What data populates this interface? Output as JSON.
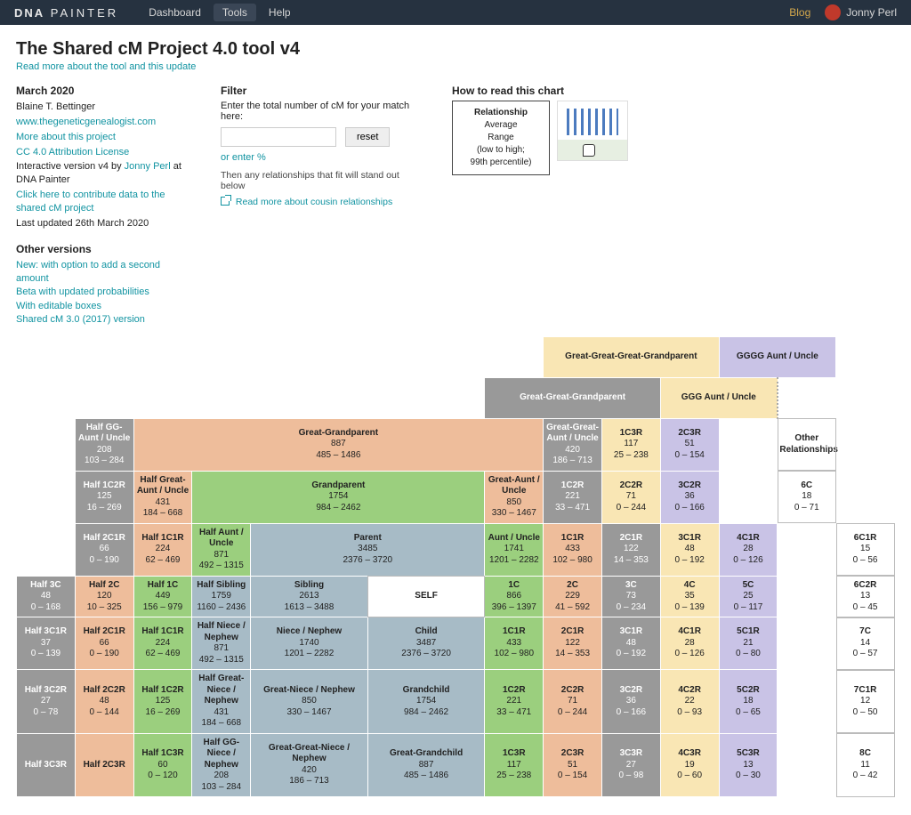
{
  "nav": {
    "logo_a": "DNA",
    "logo_b": "PAINTER",
    "items": [
      "Dashboard",
      "Tools",
      "Help"
    ],
    "active_index": 1,
    "blog": "Blog",
    "user": "Jonny Perl"
  },
  "page": {
    "title": "The Shared cM Project 4.0 tool v4",
    "sub_link": "Read more about the tool and this update"
  },
  "meta": {
    "date_heading": "March 2020",
    "author": "Blaine T. Bettinger",
    "site_link": "www.thegeneticgenealogist.com",
    "more_link": "More about this project",
    "license_link": "CC 4.0 Attribution License",
    "interactive_prefix": "Interactive version v4 by ",
    "interactive_link": "Jonny Perl",
    "interactive_mid": " at ",
    "interactive_suffix": "DNA Painter",
    "contribute_link": "Click here to contribute data to the shared cM project",
    "last_updated": "Last updated 26th March 2020"
  },
  "other": {
    "heading": "Other versions",
    "links": [
      "New: with option to add a second amount",
      "Beta with updated probabilities",
      "With editable boxes",
      "Shared cM 3.0 (2017) version"
    ]
  },
  "filter": {
    "heading": "Filter",
    "prompt": "Enter the total number of cM for your match here:",
    "placeholder": "",
    "reset": "reset",
    "pct": "or enter %",
    "hint": "Then any relationships that fit will stand out below",
    "more": "Read more about cousin relationships"
  },
  "howto": {
    "heading": "How to read this chart",
    "rel": "Relationship",
    "avg": "Average",
    "range": "Range",
    "note1": "(low to high;",
    "note2": "99th percentile)"
  },
  "top_labels": {
    "ggg_grand": "Great-Great-Great-Grandparent",
    "gggg_au": "GGGG Aunt / Uncle",
    "gg_grand": "Great-Great-Grandparent",
    "ggg_au": "GGG Aunt / Uncle"
  },
  "chart_data": {
    "type": "table",
    "note": "Cells list [label, average_cM, range_string]; null = empty cell; spans noted in markup.",
    "rows": [
      {
        "r": 1,
        "cells": {
          "half_gg_au": [
            "Half GG-Aunt / Uncle",
            208,
            "103 – 284"
          ],
          "g_grand": [
            "Great-Grandparent",
            887,
            "485 – 1486"
          ],
          "gg_au": [
            "Great-Great-Aunt / Uncle",
            420,
            "186 – 713"
          ],
          "1c3r": [
            "1C3R",
            117,
            "25 – 238"
          ],
          "2c3r": [
            "2C3R",
            51,
            "0 – 154"
          ],
          "other": [
            "Other Relationships",
            null,
            null
          ]
        }
      },
      {
        "r": 2,
        "cells": {
          "half_1c2r": [
            "Half 1C2R",
            125,
            "16 – 269"
          ],
          "half_g_au": [
            "Half Great-Aunt / Uncle",
            431,
            "184 – 668"
          ],
          "grand": [
            "Grandparent",
            1754,
            "984 – 2462"
          ],
          "g_au": [
            "Great-Aunt / Uncle",
            850,
            "330 – 1467"
          ],
          "1c2r": [
            "1C2R",
            221,
            "33 – 471"
          ],
          "2c2r": [
            "2C2R",
            71,
            "0 – 244"
          ],
          "3c2r": [
            "3C2R",
            36,
            "0 – 166"
          ],
          "6c": [
            "6C",
            18,
            "0 – 71"
          ]
        }
      },
      {
        "r": 3,
        "cells": {
          "half_2c1r": [
            "Half 2C1R",
            66,
            "0 – 190"
          ],
          "half_1c1r": [
            "Half 1C1R",
            224,
            "62 – 469"
          ],
          "half_au": [
            "Half Aunt / Uncle",
            871,
            "492 – 1315"
          ],
          "parent": [
            "Parent",
            3485,
            "2376 – 3720"
          ],
          "au": [
            "Aunt / Uncle",
            1741,
            "1201 – 2282"
          ],
          "1c1r": [
            "1C1R",
            433,
            "102 – 980"
          ],
          "2c1r": [
            "2C1R",
            122,
            "14 – 353"
          ],
          "3c1r": [
            "3C1R",
            48,
            "0 – 192"
          ],
          "4c1r": [
            "4C1R",
            28,
            "0 – 126"
          ],
          "6c1r": [
            "6C1R",
            15,
            "0 – 56"
          ]
        }
      },
      {
        "r": 4,
        "cells": {
          "half_3c": [
            "Half 3C",
            48,
            "0 – 168"
          ],
          "half_2c": [
            "Half 2C",
            120,
            "10 – 325"
          ],
          "half_1c": [
            "Half 1C",
            449,
            "156 – 979"
          ],
          "half_sib": [
            "Half Sibling",
            1759,
            "1160 – 2436"
          ],
          "sib": [
            "Sibling",
            2613,
            "1613 – 3488"
          ],
          "self": [
            "SELF",
            null,
            null
          ],
          "1c": [
            "1C",
            866,
            "396 – 1397"
          ],
          "2c": [
            "2C",
            229,
            "41 – 592"
          ],
          "3c": [
            "3C",
            73,
            "0 – 234"
          ],
          "4c": [
            "4C",
            35,
            "0 – 139"
          ],
          "5c": [
            "5C",
            25,
            "0 – 117"
          ],
          "6c2r": [
            "6C2R",
            13,
            "0 – 45"
          ]
        }
      },
      {
        "r": 5,
        "cells": {
          "half_3c1r": [
            "Half 3C1R",
            37,
            "0 – 139"
          ],
          "half_2c1r": [
            "Half 2C1R",
            66,
            "0 – 190"
          ],
          "half_1c1r": [
            "Half 1C1R",
            224,
            "62 – 469"
          ],
          "half_nn": [
            "Half Niece / Nephew",
            871,
            "492 – 1315"
          ],
          "nn": [
            "Niece / Nephew",
            1740,
            "1201 – 2282"
          ],
          "child": [
            "Child",
            3487,
            "2376 – 3720"
          ],
          "1c1r": [
            "1C1R",
            433,
            "102 – 980"
          ],
          "2c1r": [
            "2C1R",
            122,
            "14 – 353"
          ],
          "3c1r": [
            "3C1R",
            48,
            "0 – 192"
          ],
          "4c1r": [
            "4C1R",
            28,
            "0 – 126"
          ],
          "5c1r": [
            "5C1R",
            21,
            "0 – 80"
          ],
          "7c": [
            "7C",
            14,
            "0 – 57"
          ]
        }
      },
      {
        "r": 6,
        "cells": {
          "half_3c2r": [
            "Half 3C2R",
            27,
            "0 – 78"
          ],
          "half_2c2r": [
            "Half 2C2R",
            48,
            "0 – 144"
          ],
          "half_1c2r": [
            "Half 1C2R",
            125,
            "16 – 269"
          ],
          "half_gnn": [
            "Half Great-Niece / Nephew",
            431,
            "184 – 668"
          ],
          "gnn": [
            "Great-Niece / Nephew",
            850,
            "330 – 1467"
          ],
          "gchild": [
            "Grandchild",
            1754,
            "984 – 2462"
          ],
          "1c2r": [
            "1C2R",
            221,
            "33 – 471"
          ],
          "2c2r": [
            "2C2R",
            71,
            "0 – 244"
          ],
          "3c2r": [
            "3C2R",
            36,
            "0 – 166"
          ],
          "4c2r": [
            "4C2R",
            22,
            "0 – 93"
          ],
          "5c2r": [
            "5C2R",
            18,
            "0 – 65"
          ],
          "7c1r": [
            "7C1R",
            12,
            "0 – 50"
          ]
        }
      },
      {
        "r": 7,
        "cells": {
          "half_3c3r": [
            "Half 3C3R",
            null,
            null
          ],
          "half_2c3r": [
            "Half 2C3R",
            null,
            null
          ],
          "half_1c3r": [
            "Half 1C3R",
            60,
            "0 – 120"
          ],
          "half_ggnn": [
            "Half GG-Niece / Nephew",
            208,
            "103 – 284"
          ],
          "ggnn": [
            "Great-Great-Niece / Nephew",
            420,
            "186 – 713"
          ],
          "ggchild": [
            "Great-Grandchild",
            887,
            "485 – 1486"
          ],
          "1c3r": [
            "1C3R",
            117,
            "25 – 238"
          ],
          "2c3r": [
            "2C3R",
            51,
            "0 – 154"
          ],
          "3c3r": [
            "3C3R",
            27,
            "0 – 98"
          ],
          "4c3r": [
            "4C3R",
            19,
            "0 – 60"
          ],
          "5c3r": [
            "5C3R",
            13,
            "0 – 30"
          ],
          "8c": [
            "8C",
            11,
            "0 – 42"
          ]
        }
      }
    ]
  }
}
